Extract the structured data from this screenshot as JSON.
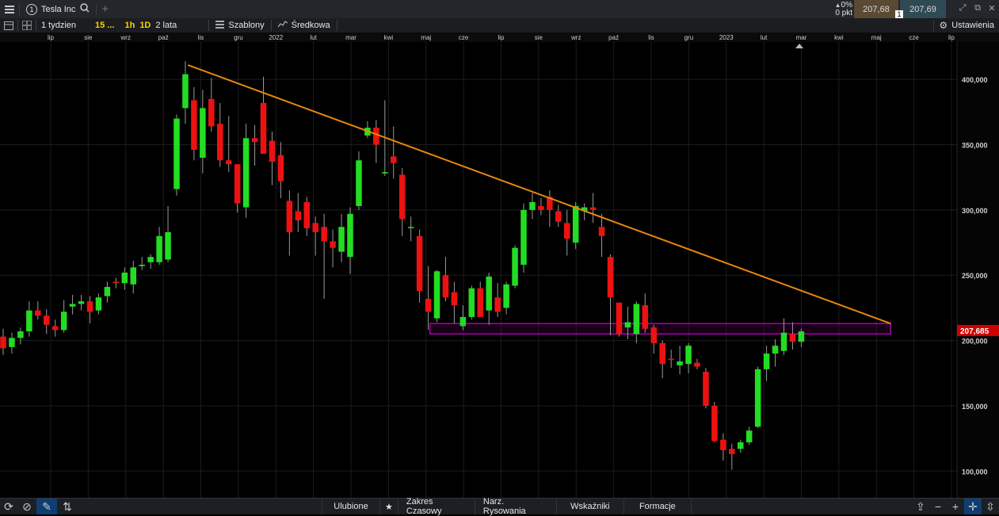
{
  "header": {
    "instrument": "Tesla Inc",
    "instrument_number": "1",
    "change_percent": "0%",
    "change_points": "0 pkt",
    "sell_price": "207,68",
    "buy_price": "207,69",
    "quantity": "1"
  },
  "toolbar": {
    "interval": "1 tydzien",
    "quick_15": "15 ...",
    "quick_1h": "1h",
    "quick_1d": "1D",
    "range": "2 lata",
    "templates": "Szablony",
    "indicator": "Średkowa",
    "settings": "Ustawienia"
  },
  "bottom": {
    "favorites": "Ulubione",
    "time_range": "Zakres Czasowy",
    "drawing_tools": "Narz. Rysowania",
    "indicators": "Wskaźniki",
    "formations": "Formacje"
  },
  "colors": {
    "up": "#22dd22",
    "down": "#ee1111",
    "trendline": "#e8870e",
    "zone": "#c000c0",
    "price_label_bg": "#d10000"
  },
  "chart_data": {
    "type": "candlestick",
    "timeframe": "1 week",
    "ylim": [
      85,
      425
    ],
    "y_ticks": [
      "400,000",
      "350,000",
      "300,000",
      "250,000",
      "200,000",
      "150,000",
      "100,000"
    ],
    "y_tick_values": [
      400,
      350,
      300,
      250,
      200,
      150,
      100
    ],
    "x_labels": [
      "lip",
      "sie",
      "wrz",
      "paź",
      "lis",
      "gru",
      "2022",
      "lut",
      "mar",
      "kwi",
      "maj",
      "cze",
      "lip",
      "sie",
      "wrz",
      "paź",
      "lis",
      "gru",
      "2023",
      "lut",
      "mar",
      "kwi",
      "maj",
      "cze",
      "lip"
    ],
    "last_price_label": "207,685",
    "last_price": 207.685,
    "candles": [
      {
        "o": 203,
        "h": 209,
        "l": 189,
        "c": 194
      },
      {
        "o": 195,
        "h": 206,
        "l": 190,
        "c": 202
      },
      {
        "o": 202,
        "h": 210,
        "l": 197,
        "c": 207
      },
      {
        "o": 207,
        "h": 230,
        "l": 203,
        "c": 223
      },
      {
        "o": 223,
        "h": 230,
        "l": 216,
        "c": 219
      },
      {
        "o": 219,
        "h": 224,
        "l": 205,
        "c": 212
      },
      {
        "o": 211,
        "h": 216,
        "l": 203,
        "c": 208
      },
      {
        "o": 208,
        "h": 231,
        "l": 206,
        "c": 222
      },
      {
        "o": 226,
        "h": 235,
        "l": 220,
        "c": 228
      },
      {
        "o": 228,
        "h": 235,
        "l": 223,
        "c": 230
      },
      {
        "o": 230,
        "h": 234,
        "l": 213,
        "c": 222
      },
      {
        "o": 223,
        "h": 236,
        "l": 220,
        "c": 233
      },
      {
        "o": 234,
        "h": 245,
        "l": 229,
        "c": 241
      },
      {
        "o": 245,
        "h": 248,
        "l": 240,
        "c": 244
      },
      {
        "o": 244,
        "h": 256,
        "l": 239,
        "c": 252
      },
      {
        "o": 243,
        "h": 261,
        "l": 236,
        "c": 256
      },
      {
        "o": 257,
        "h": 264,
        "l": 254,
        "c": 258
      },
      {
        "o": 260,
        "h": 266,
        "l": 255,
        "c": 264
      },
      {
        "o": 260,
        "h": 287,
        "l": 258,
        "c": 280
      },
      {
        "o": 262,
        "h": 303,
        "l": 260,
        "c": 283
      },
      {
        "o": 316,
        "h": 373,
        "l": 311,
        "c": 370
      },
      {
        "o": 378,
        "h": 414,
        "l": 366,
        "c": 404
      },
      {
        "o": 384,
        "h": 394,
        "l": 338,
        "c": 346
      },
      {
        "o": 340,
        "h": 392,
        "l": 328,
        "c": 378
      },
      {
        "o": 385,
        "h": 401,
        "l": 360,
        "c": 364
      },
      {
        "o": 366,
        "h": 382,
        "l": 333,
        "c": 338
      },
      {
        "o": 338,
        "h": 372,
        "l": 329,
        "c": 335
      },
      {
        "o": 335,
        "h": 335,
        "l": 298,
        "c": 305
      },
      {
        "o": 302,
        "h": 366,
        "l": 294,
        "c": 355
      },
      {
        "o": 355,
        "h": 365,
        "l": 334,
        "c": 352
      },
      {
        "o": 382,
        "h": 402,
        "l": 354,
        "c": 343
      },
      {
        "o": 353,
        "h": 360,
        "l": 319,
        "c": 337
      },
      {
        "o": 342,
        "h": 352,
        "l": 309,
        "c": 322
      },
      {
        "o": 307,
        "h": 315,
        "l": 265,
        "c": 283
      },
      {
        "o": 299,
        "h": 313,
        "l": 283,
        "c": 292
      },
      {
        "o": 306,
        "h": 310,
        "l": 280,
        "c": 286
      },
      {
        "o": 290,
        "h": 295,
        "l": 265,
        "c": 283
      },
      {
        "o": 287,
        "h": 297,
        "l": 232,
        "c": 276
      },
      {
        "o": 276,
        "h": 285,
        "l": 256,
        "c": 271
      },
      {
        "o": 268,
        "h": 297,
        "l": 260,
        "c": 287
      },
      {
        "o": 264,
        "h": 302,
        "l": 251,
        "c": 297
      },
      {
        "o": 303,
        "h": 345,
        "l": 300,
        "c": 338
      },
      {
        "o": 357,
        "h": 368,
        "l": 355,
        "c": 363
      },
      {
        "o": 363,
        "h": 369,
        "l": 336,
        "c": 350
      },
      {
        "o": 328,
        "h": 384,
        "l": 326,
        "c": 329
      },
      {
        "o": 341,
        "h": 364,
        "l": 324,
        "c": 336
      },
      {
        "o": 327,
        "h": 332,
        "l": 280,
        "c": 293
      },
      {
        "o": 287,
        "h": 295,
        "l": 276,
        "c": 287
      },
      {
        "o": 280,
        "h": 285,
        "l": 229,
        "c": 238
      },
      {
        "o": 232,
        "h": 257,
        "l": 208,
        "c": 222
      },
      {
        "o": 217,
        "h": 254,
        "l": 214,
        "c": 253
      },
      {
        "o": 250,
        "h": 264,
        "l": 230,
        "c": 233
      },
      {
        "o": 237,
        "h": 245,
        "l": 213,
        "c": 227
      },
      {
        "o": 211,
        "h": 227,
        "l": 208,
        "c": 218
      },
      {
        "o": 218,
        "h": 242,
        "l": 216,
        "c": 240
      },
      {
        "o": 240,
        "h": 245,
        "l": 218,
        "c": 218
      },
      {
        "o": 223,
        "h": 252,
        "l": 212,
        "c": 249
      },
      {
        "o": 233,
        "h": 244,
        "l": 218,
        "c": 222
      },
      {
        "o": 225,
        "h": 245,
        "l": 220,
        "c": 243
      },
      {
        "o": 242,
        "h": 273,
        "l": 240,
        "c": 271
      },
      {
        "o": 258,
        "h": 305,
        "l": 252,
        "c": 300
      },
      {
        "o": 300,
        "h": 313,
        "l": 293,
        "c": 306
      },
      {
        "o": 303,
        "h": 309,
        "l": 296,
        "c": 300
      },
      {
        "o": 310,
        "h": 315,
        "l": 287,
        "c": 300
      },
      {
        "o": 299,
        "h": 304,
        "l": 287,
        "c": 291
      },
      {
        "o": 290,
        "h": 300,
        "l": 265,
        "c": 278
      },
      {
        "o": 275,
        "h": 306,
        "l": 270,
        "c": 303
      },
      {
        "o": 299,
        "h": 305,
        "l": 292,
        "c": 302
      },
      {
        "o": 302,
        "h": 313,
        "l": 290,
        "c": 300
      },
      {
        "o": 287,
        "h": 297,
        "l": 264,
        "c": 280
      },
      {
        "o": 264,
        "h": 266,
        "l": 204,
        "c": 233
      },
      {
        "o": 229,
        "h": 229,
        "l": 203,
        "c": 205
      },
      {
        "o": 210,
        "h": 226,
        "l": 201,
        "c": 214
      },
      {
        "o": 205,
        "h": 230,
        "l": 198,
        "c": 228
      },
      {
        "o": 227,
        "h": 236,
        "l": 206,
        "c": 209
      },
      {
        "o": 210,
        "h": 212,
        "l": 190,
        "c": 198
      },
      {
        "o": 198,
        "h": 200,
        "l": 171,
        "c": 182
      },
      {
        "o": 186,
        "h": 193,
        "l": 179,
        "c": 185
      },
      {
        "o": 181,
        "h": 196,
        "l": 174,
        "c": 184
      },
      {
        "o": 182,
        "h": 198,
        "l": 175,
        "c": 196
      },
      {
        "o": 183,
        "h": 186,
        "l": 178,
        "c": 180
      },
      {
        "o": 176,
        "h": 179,
        "l": 148,
        "c": 150
      },
      {
        "o": 150,
        "h": 153,
        "l": 122,
        "c": 123
      },
      {
        "o": 124,
        "h": 129,
        "l": 108,
        "c": 116
      },
      {
        "o": 117,
        "h": 121,
        "l": 101,
        "c": 113
      },
      {
        "o": 117,
        "h": 124,
        "l": 114,
        "c": 122
      },
      {
        "o": 122,
        "h": 134,
        "l": 120,
        "c": 131
      },
      {
        "o": 134,
        "h": 180,
        "l": 133,
        "c": 178
      },
      {
        "o": 178,
        "h": 196,
        "l": 169,
        "c": 190
      },
      {
        "o": 190,
        "h": 201,
        "l": 180,
        "c": 196
      },
      {
        "o": 192,
        "h": 217,
        "l": 189,
        "c": 206
      },
      {
        "o": 205,
        "h": 214,
        "l": 193,
        "c": 199
      },
      {
        "o": 199,
        "h": 209,
        "l": 195,
        "c": 207
      }
    ],
    "trendline": {
      "start_index": 21.3,
      "start_value": 411,
      "end_index": 102.3,
      "end_value": 213
    },
    "zone": {
      "start_index": 49.2,
      "end_index": 102.3,
      "low": 205,
      "high": 213
    }
  }
}
